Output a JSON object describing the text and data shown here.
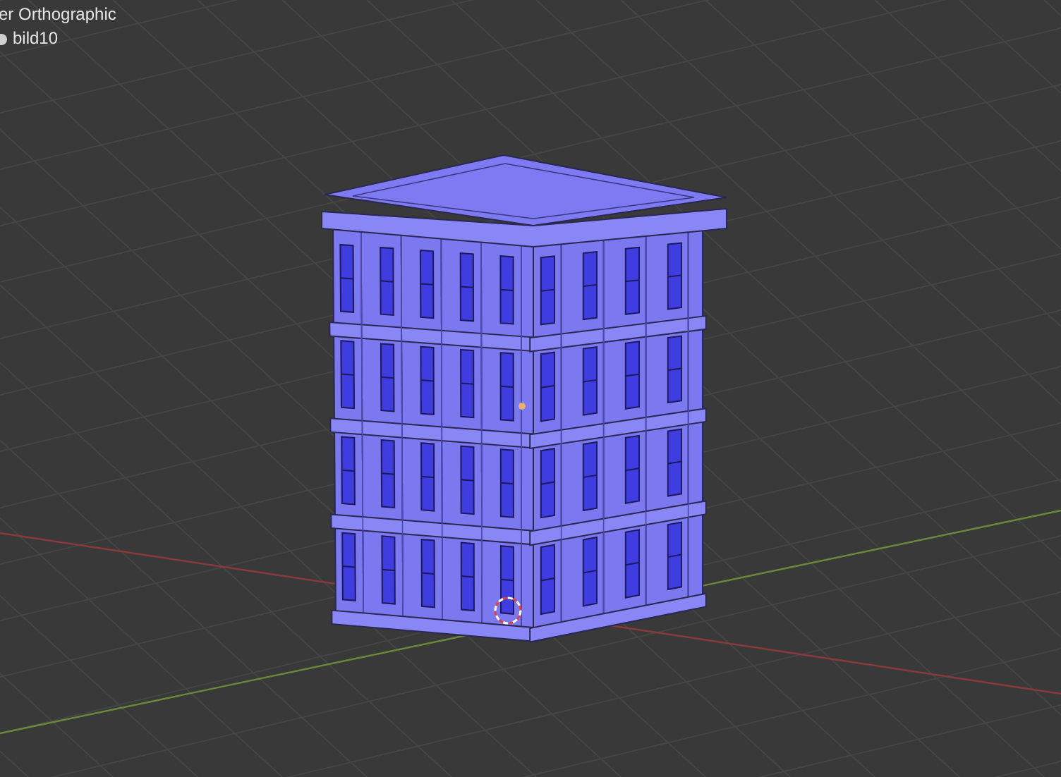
{
  "viewport": {
    "view_label": "er Orthographic",
    "object_label": "bild10"
  }
}
